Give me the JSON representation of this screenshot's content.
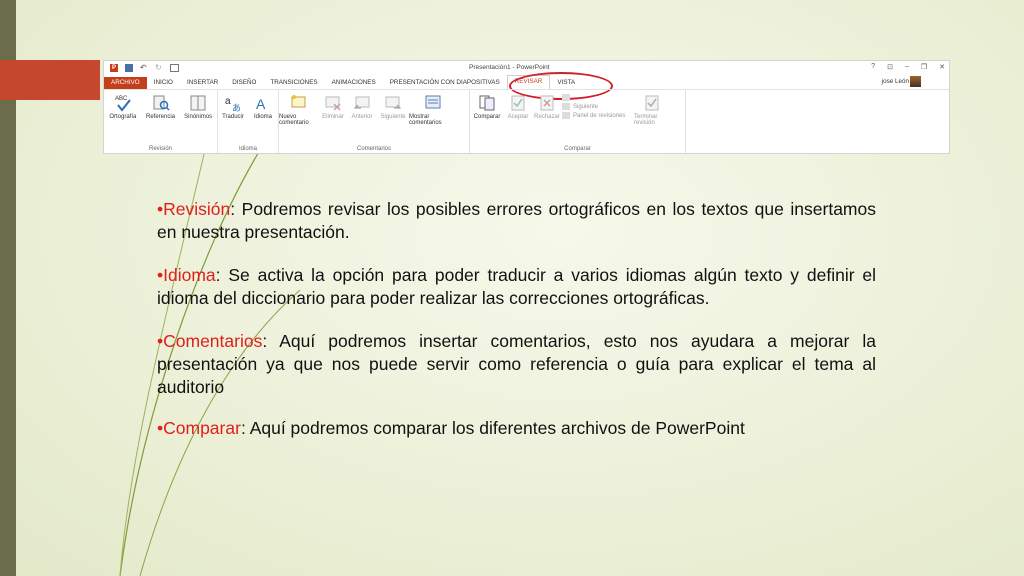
{
  "ribbon": {
    "window_title": "Presentación1 - PowerPoint",
    "window_controls": [
      "?",
      "⊡",
      "–",
      "❐",
      "✕"
    ],
    "user_name": "jose León",
    "tabs": [
      "ARCHIVO",
      "INICIO",
      "INSERTAR",
      "DISEÑO",
      "TRANSICIONES",
      "ANIMACIONES",
      "PRESENTACIÓN CON DIAPOSITIVAS",
      "REVISAR",
      "VISTA"
    ],
    "active_tab": "REVISAR",
    "groups": {
      "revision": {
        "label": "Revisión",
        "buttons": [
          "Ortografía",
          "Referencia",
          "Sinónimos"
        ]
      },
      "idioma": {
        "label": "Idioma",
        "buttons": [
          "Traducir",
          "Idioma"
        ]
      },
      "comentarios": {
        "label": "Comentarios",
        "buttons": [
          "Nuevo comentario",
          "Eliminar",
          "Anterior",
          "Siguiente",
          "Mostrar comentarios"
        ]
      },
      "comparar": {
        "label": "Comparar",
        "buttons": [
          "Comparar",
          "Aceptar",
          "Rechazar",
          "Siguiente",
          "Panel de revisiones",
          "Terminar revisión"
        ]
      }
    },
    "abc": "ABC"
  },
  "bullets": [
    {
      "keyword": "•Revisión",
      "text": ": Podremos revisar los posibles errores ortográficos en los textos que insertamos en nuestra presentación."
    },
    {
      "keyword": "•Idioma",
      "text": ": Se activa la opción para poder traducir a varios idiomas algún texto y definir el idioma del diccionario para poder realizar las correcciones ortográficas."
    },
    {
      "keyword": "•Comentarios",
      "text": ": Aquí podremos insertar comentarios, esto nos ayudara a mejorar la presentación ya que nos puede servir como referencia o guía para explicar el tema al auditorio"
    },
    {
      "keyword": "•Comparar",
      "text": ": Aquí podremos comparar los diferentes archivos de PowerPoint"
    }
  ],
  "colors": {
    "keyword": "#e0201a",
    "accent": "#c4482d",
    "side_bar": "#6b6c4b",
    "highlight_circle": "#d0202a"
  }
}
